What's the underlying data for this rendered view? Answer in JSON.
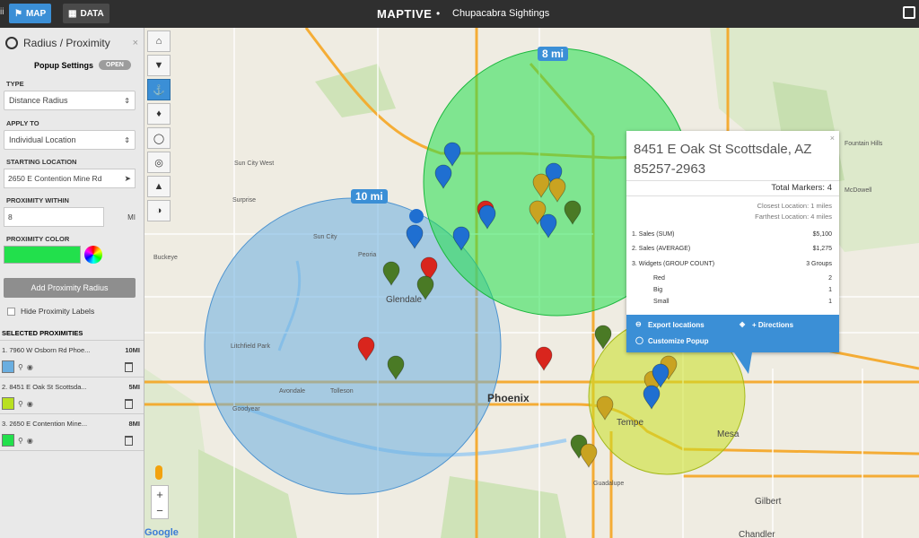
{
  "topbar": {
    "left_edge": "ii",
    "map_tab": "MAP",
    "data_tab": "DATA",
    "brand": "MAPTIVE",
    "dot": "•",
    "map_title": "Chupacabra Sightings"
  },
  "panel": {
    "title": "Radius / Proximity",
    "close": "×",
    "popup_settings": "Popup Settings",
    "open_button": "OPEN",
    "type_label": "TYPE",
    "type_value": "Distance Radius",
    "apply_label": "APPLY TO",
    "apply_value": "Individual Location",
    "start_label": "STARTING LOCATION",
    "start_value": "2650 E Contention Mine Rd",
    "within_label": "PROXIMITY WITHIN",
    "within_value": "8",
    "within_unit": "MI",
    "color_label": "PROXIMITY COLOR",
    "add_button": "Add Proximity Radius",
    "hide_labels": "Hide Proximity Labels",
    "selected_label": "SELECTED PROXIMITIES",
    "items": [
      {
        "name": "1. 7960 W Osborn Rd Phoe...",
        "dist": "10MI",
        "color": "#6aaee0"
      },
      {
        "name": "2. 8451 E Oak St Scottsda...",
        "dist": "5MI",
        "color": "#b9e021"
      },
      {
        "name": "3. 2650 E Contention Mine...",
        "dist": "8MI",
        "color": "#22e04c"
      }
    ]
  },
  "map": {
    "tools": [
      "⌂",
      "▼",
      "⚓",
      "♦",
      "◯",
      "◎",
      "▲",
      "◑"
    ],
    "zoom_in": "+",
    "zoom_out": "−",
    "google": "Google",
    "radius_labels": {
      "big": "10 mi",
      "green": "8 mi"
    },
    "cities": {
      "phoenix": "Phoenix",
      "glendale": "Glendale",
      "tempe": "Tempe",
      "mesa": "Mesa",
      "gilbert": "Gilbert",
      "peoria": "Peoria",
      "surprise": "Surprise",
      "sun_city_west": "Sun City West",
      "sun_city": "Sun City",
      "goodyear": "Goodyear",
      "tolleson": "Tolleson",
      "avondale": "Avondale",
      "litchfield": "Litchfield Park",
      "guadalupe": "Guadalupe",
      "fountain_hills": "Fountain Hills",
      "mcdowell": "McDowell",
      "buckeye": "Buckeye",
      "chandler": "Chandler"
    }
  },
  "popup": {
    "close": "×",
    "address": "8451 E Oak St Scottsdale, AZ 85257-2963",
    "total": "Total Markers: 4",
    "closest": "Closest Location: 1 miles",
    "farthest": "Farthest Location: 4 miles",
    "rows": [
      {
        "label": "1. Sales (SUM)",
        "value": "$5,100"
      },
      {
        "label": "2. Sales (AVERAGE)",
        "value": "$1,275"
      },
      {
        "label": "3. Widgets (GROUP COUNT)",
        "value": "3 Groups"
      }
    ],
    "sub_rows": [
      {
        "label": "Red",
        "value": "2"
      },
      {
        "label": "Big",
        "value": "1"
      },
      {
        "label": "Small",
        "value": "1"
      }
    ],
    "export": "Export locations",
    "directions": "+ Directions",
    "customize": "Customize Popup"
  },
  "colors": {
    "accent": "#3b8fd6",
    "radius_blue": "#6aaee0",
    "radius_green": "#22e04c",
    "radius_yellow": "#c8e021",
    "pin_blue": "#1f6fd1",
    "pin_red": "#d9251d",
    "pin_green": "#4a7a25",
    "pin_yellow": "#c9a321"
  }
}
